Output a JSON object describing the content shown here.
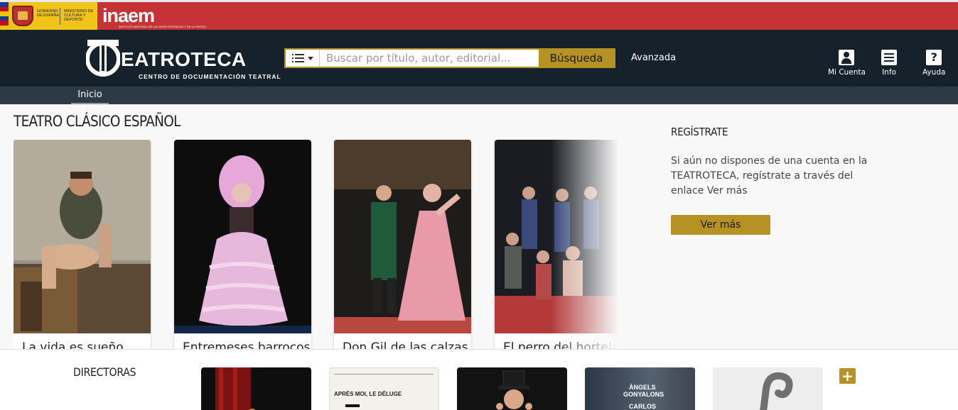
{
  "gov": {
    "gobierno": "GOBIERNO DE ESPAÑA",
    "ministerio": "MINISTERIO DE CULTURA Y DEPORTE",
    "inaem_logo": "inaem",
    "inaem_sub": "INSTITUTO NACIONAL DE LAS ARTES ESCÉNICAS Y DE LA MÚSICA"
  },
  "header": {
    "brand_title": "EATROTECA",
    "brand_subtitle": "CENTRO DE DOCUMENTACIÓN TEATRAL",
    "search_placeholder": "Buscar por título, autor, editorial...",
    "search_button": "Búsqueda",
    "advanced_link": "Avanzada",
    "tools": [
      {
        "label": "Mi Cuenta",
        "icon": "user-icon"
      },
      {
        "label": "Info",
        "icon": "menu-icon"
      },
      {
        "label": "Ayuda",
        "icon": "help-icon",
        "glyph": "?"
      }
    ]
  },
  "subnav": {
    "items": [
      "Inicio"
    ]
  },
  "main": {
    "section_title": "TEATRO CLÁSICO ESPAÑOL",
    "cards": [
      {
        "caption": "La vida es sueño"
      },
      {
        "caption": "Entremeses barrocos"
      },
      {
        "caption": "Don Gil de las calzas verdes"
      },
      {
        "caption": "El perro del hortelano"
      }
    ],
    "register": {
      "title": "REGÍSTRATE",
      "text": "Si aún no dispones de una cuenta en la TEATROTECA, regístrate a través del enlace Ver más",
      "button": "Ver más"
    }
  },
  "directors": {
    "title": "DIRECTORAS",
    "thumb2_text": "APRÈS MOI, LE DÉLUGE",
    "thumb4_line1": "ÀNGELS",
    "thumb4_line2": "GONYALONS",
    "thumb4_line3": "CARLOS",
    "more_button": "+"
  },
  "colors": {
    "gold": "#b69224",
    "header_dark": "#16222b",
    "gov_red": "#c63336"
  }
}
